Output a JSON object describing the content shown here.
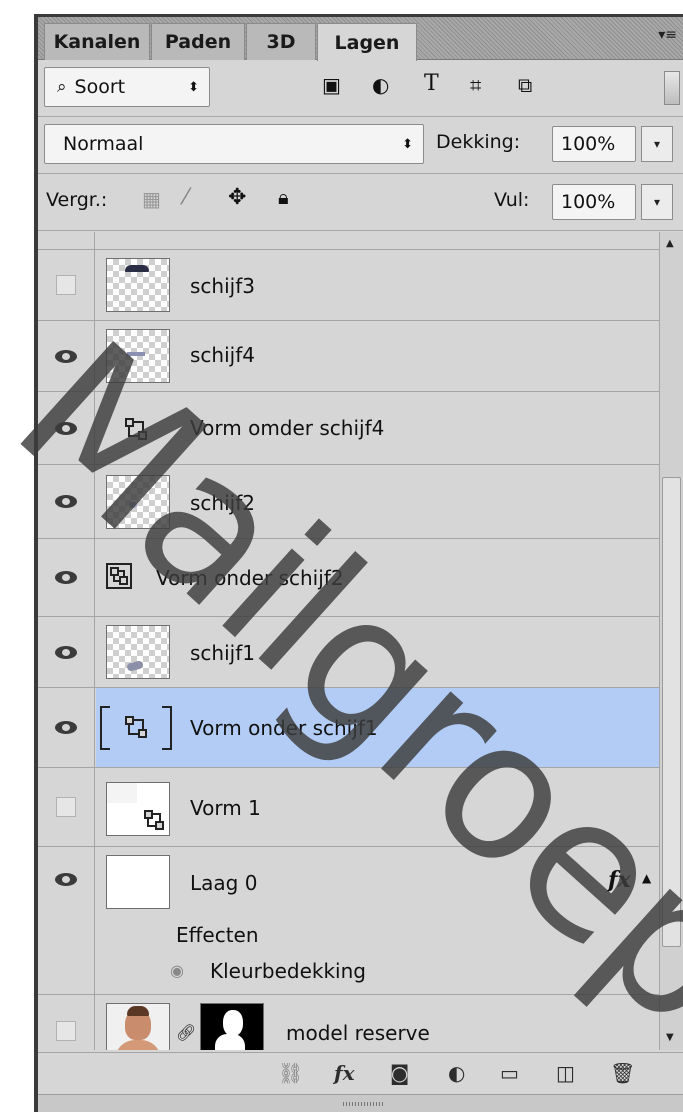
{
  "tabs": [
    {
      "label": "Kanalen",
      "active": false
    },
    {
      "label": "Paden",
      "active": false
    },
    {
      "label": "3D",
      "active": false
    },
    {
      "label": "Lagen",
      "active": true
    }
  ],
  "filter": {
    "kind": "Soort"
  },
  "blend": {
    "mode": "Normaal",
    "opacity_label": "Dekking:",
    "opacity_value": "100%"
  },
  "lock": {
    "label": "Vergr.:",
    "fill_label": "Vul:",
    "fill_value": "100%"
  },
  "layers": [
    {
      "name": "schijf3",
      "visible": false
    },
    {
      "name": "schijf4",
      "visible": true
    },
    {
      "name": "Vorm omder schijf4",
      "visible": true
    },
    {
      "name": "schijf2",
      "visible": true
    },
    {
      "name": "Vorm onder schijf2",
      "visible": true
    },
    {
      "name": "schijf1",
      "visible": true
    },
    {
      "name": "Vorm onder schijf1",
      "visible": true,
      "selected": true
    },
    {
      "name": "Vorm 1",
      "visible": false
    },
    {
      "name": "Laag 0",
      "visible": true,
      "fx": "fx",
      "effects_label": "Effecten",
      "effect_name": "Kleurbedekking"
    },
    {
      "name": "model reserve",
      "visible": false
    }
  ],
  "watermark": "MailgroepCopy",
  "colors": {
    "panel_bg": "#d6d6d6",
    "selected_row": "#b3ccf5",
    "tab_strip": "#a0a0a0"
  }
}
